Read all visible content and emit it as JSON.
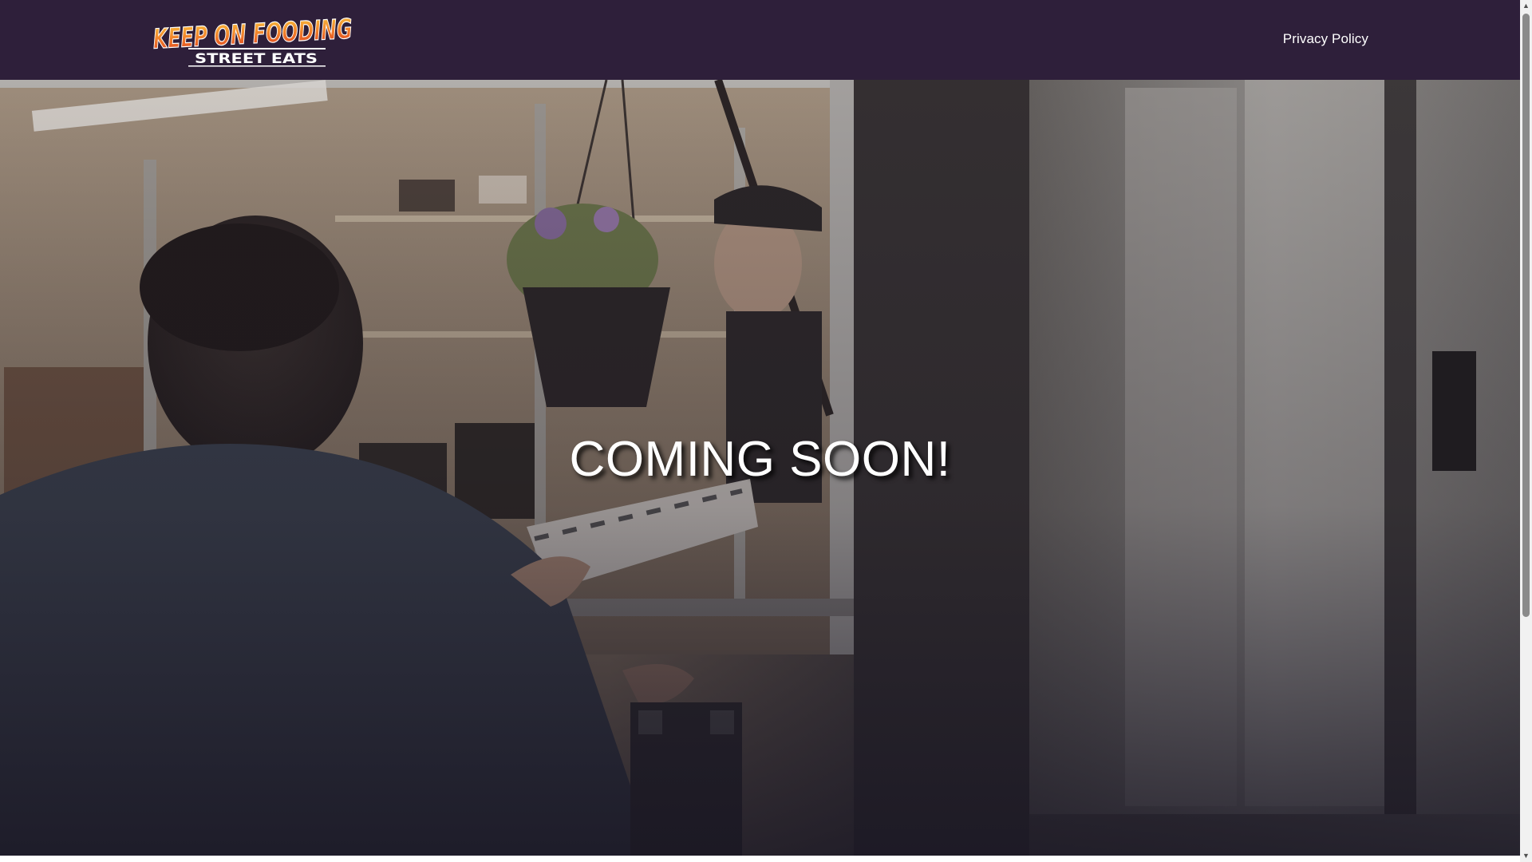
{
  "header": {
    "logo_line1": "KEEP ON FOODING",
    "logo_line2": "STREET EATS",
    "nav": {
      "privacy_label": "Privacy Policy"
    },
    "background_color": "#2e1f3a"
  },
  "hero": {
    "headline": "COMING SOON!",
    "image_description_icon": "food-truck-photo"
  },
  "colors": {
    "brand_orange": "#e8582a",
    "brand_yellow": "#f7b733",
    "header_purple": "#2e1f3a",
    "text_white": "#ffffff"
  }
}
